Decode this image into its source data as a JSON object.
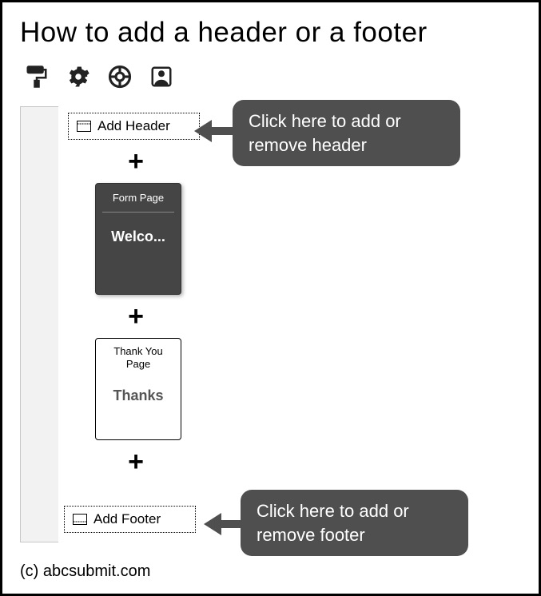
{
  "title": "How to add a header or a footer",
  "toolbar": {
    "icons": [
      "roller-icon",
      "gear-icon",
      "help-icon",
      "user-icon"
    ]
  },
  "add_header_label": "Add Header",
  "add_footer_label": "Add Footer",
  "form_page": {
    "label": "Form Page",
    "content": "Welco..."
  },
  "thank_you": {
    "label": "Thank You Page",
    "content": "Thanks"
  },
  "callouts": {
    "header": "Click here to add or remove header",
    "footer": "Click here to add or remove footer"
  },
  "copyright": "(c) abcsubmit.com"
}
